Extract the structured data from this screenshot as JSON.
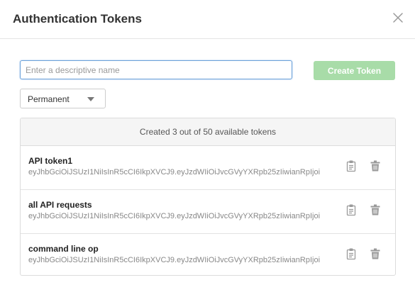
{
  "dialog": {
    "title": "Authentication Tokens",
    "name_input": {
      "value": "",
      "placeholder": "Enter a descriptive name"
    },
    "create_button": "Create Token",
    "expiry_select": {
      "selected": "Permanent"
    },
    "summary": "Created 3 out of 50 available tokens",
    "tokens": [
      {
        "name": "API token1",
        "value": "eyJhbGciOiJSUzI1NiIsInR5cCI6IkpXVCJ9.eyJzdWIiOiJvcGVyYXRpb25zIiwianRpIjoi"
      },
      {
        "name": "all API requests",
        "value": "eyJhbGciOiJSUzI1NiIsInR5cCI6IkpXVCJ9.eyJzdWIiOiJvcGVyYXRpb25zIiwianRpIjoi"
      },
      {
        "name": "command line op",
        "value": "eyJhbGciOiJSUzI1NiIsInR5cCI6IkpXVCJ9.eyJzdWIiOiJvcGVyYXRpb25zIiwianRpIjoi"
      }
    ],
    "icons": {
      "close": "close-icon",
      "copy": "clipboard-icon",
      "delete": "trash-icon"
    },
    "colors": {
      "create_button": "#a8dca8",
      "input_focus": "#6aa0d8"
    }
  }
}
